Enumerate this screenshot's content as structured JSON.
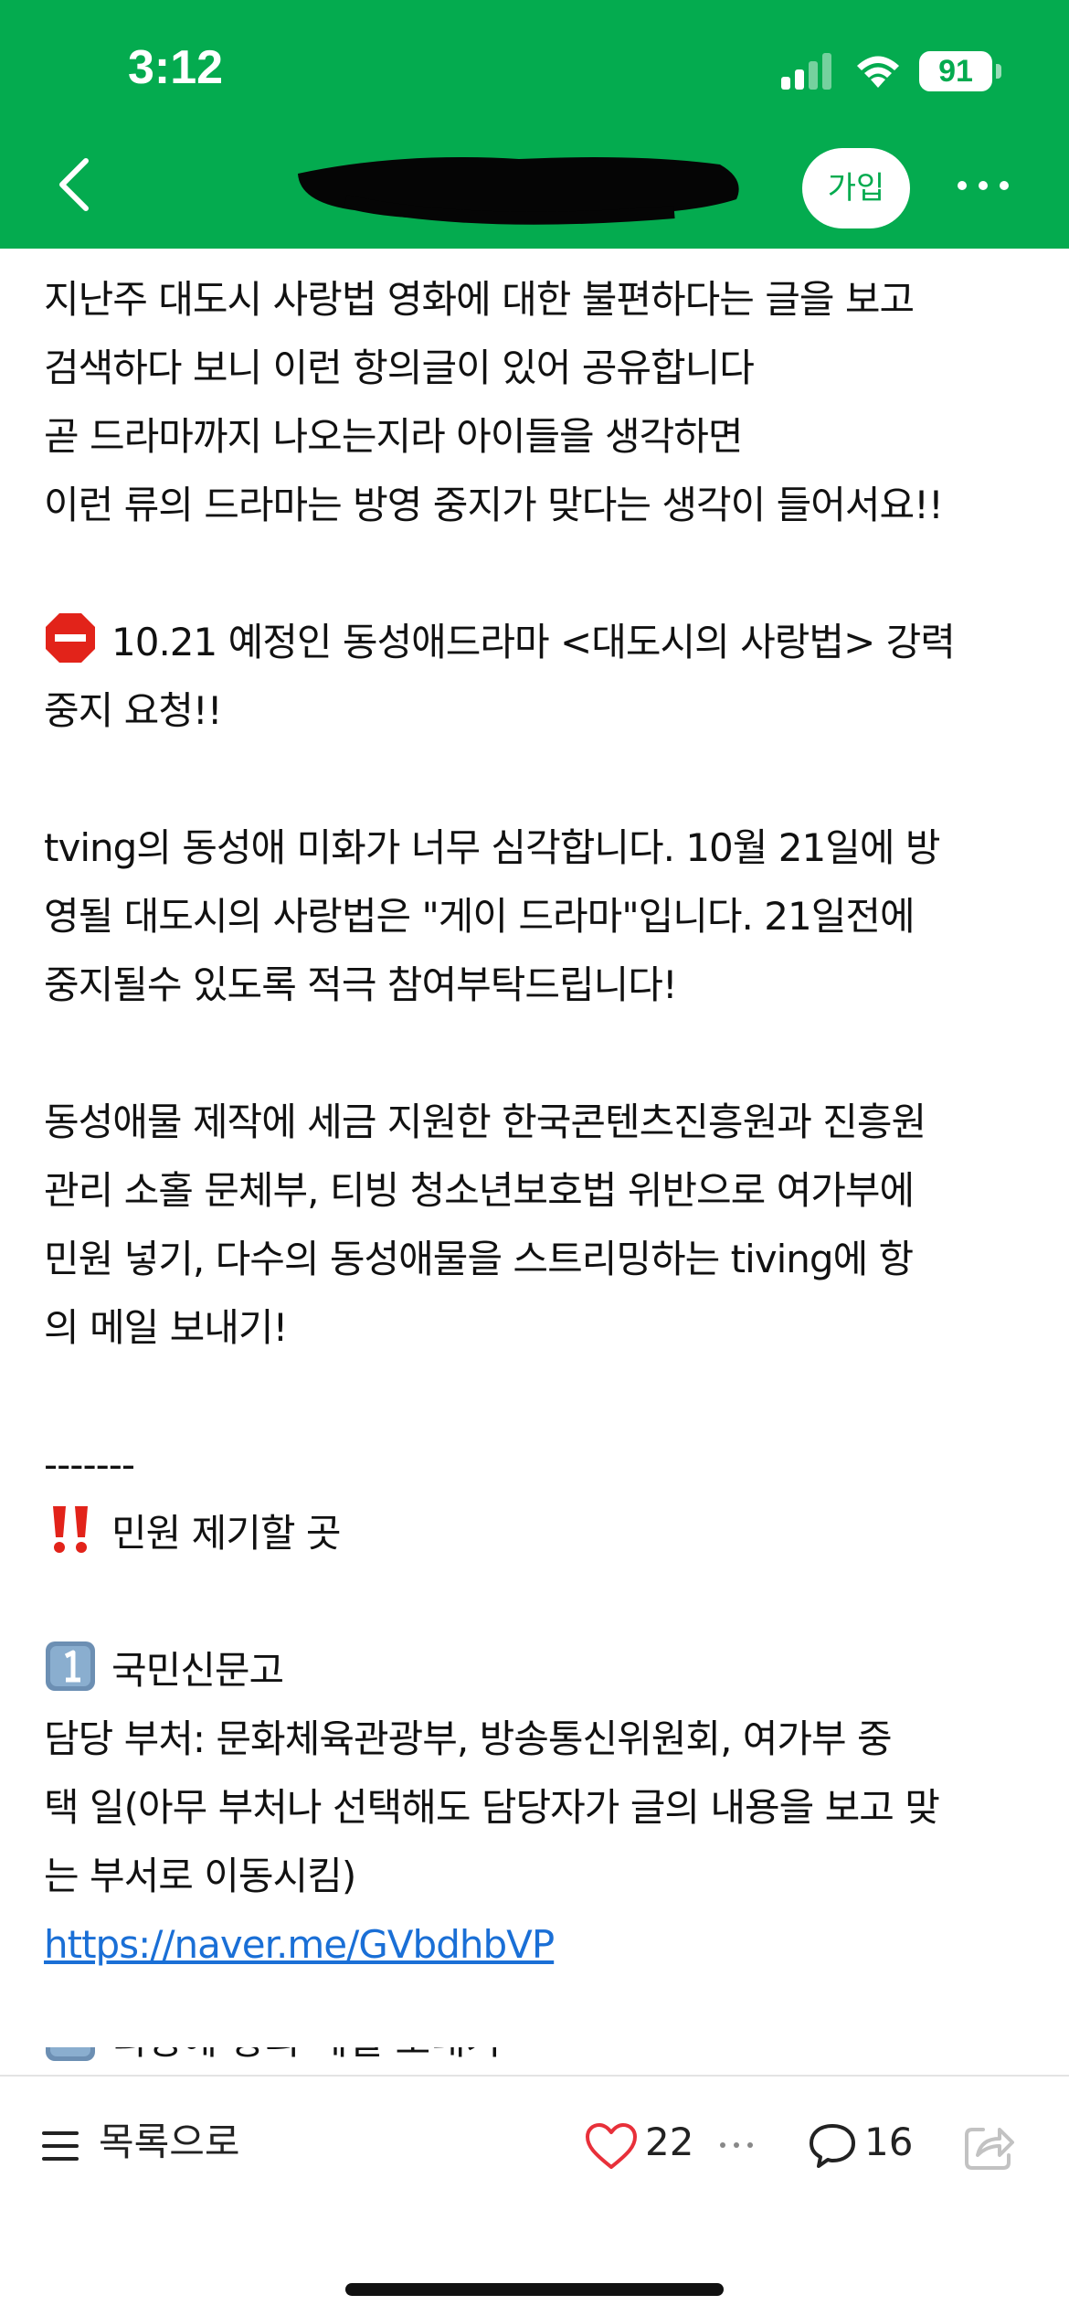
{
  "status_bar": {
    "time": "3:12",
    "battery": "91"
  },
  "header": {
    "join_label": "가입"
  },
  "post": {
    "lines": [
      "지난주 대도시 사랑법 영화에 대한 불편하다는 글을 보고",
      "검색하다 보니 이런 항의글이 있어 공유합니다",
      "곧 드라마까지 나오는지라 아이들을 생각하면",
      "이런 류의 드라마는 방영 중지가 맞다는 생각이 들어서요!!"
    ],
    "headline_1": "10.21 예정인 동성애드라마 <대도시의 사랑법> 강력",
    "headline_2": "중지 요청!!",
    "para2": [
      "tving의 동성애 미화가 너무 심각합니다. 10월 21일에 방",
      "영될 대도시의 사랑법은 \"게이 드라마\"입니다.  21일전에",
      "중지될수 있도록 적극 참여부탁드립니다!"
    ],
    "para3": [
      "동성애물 제작에 세금 지원한 한국콘텐츠진흥원과 진흥원",
      "관리 소홀 문체부, 티빙 청소년보호법 위반으로 여가부에",
      "민원 넣기, 다수의 동성애물을 스트리밍하는 tiving에 항",
      "의 메일 보내기!"
    ],
    "divider": "-------",
    "complaint_title": "민원 제기할 곳",
    "item1_title": "국민신문고",
    "item1_lines": [
      "담당 부처: 문화체육관광부, 방송통신위원회, 여가부 중",
      "택 일(아무 부처나 선택해도 담당자가 글의 내용을 보고 맞",
      "는 부서로 이동시킴)"
    ],
    "item1_link": "https://naver.me/GVbdhbVP",
    "item2_title": "티빙에 항의 메일 보내기"
  },
  "footer": {
    "list_label": "목록으로",
    "likes": "22",
    "comments": "16"
  },
  "colors": {
    "header_green": "#04ab4f",
    "link_blue": "#1a6fd6",
    "heart_red": "#e8303a"
  },
  "icons": [
    "back-arrow-icon",
    "more-icon",
    "stop-sign-icon",
    "double-exclamation-icon",
    "keycap-one-icon",
    "list-icon",
    "heart-icon",
    "comment-icon",
    "share-icon"
  ]
}
